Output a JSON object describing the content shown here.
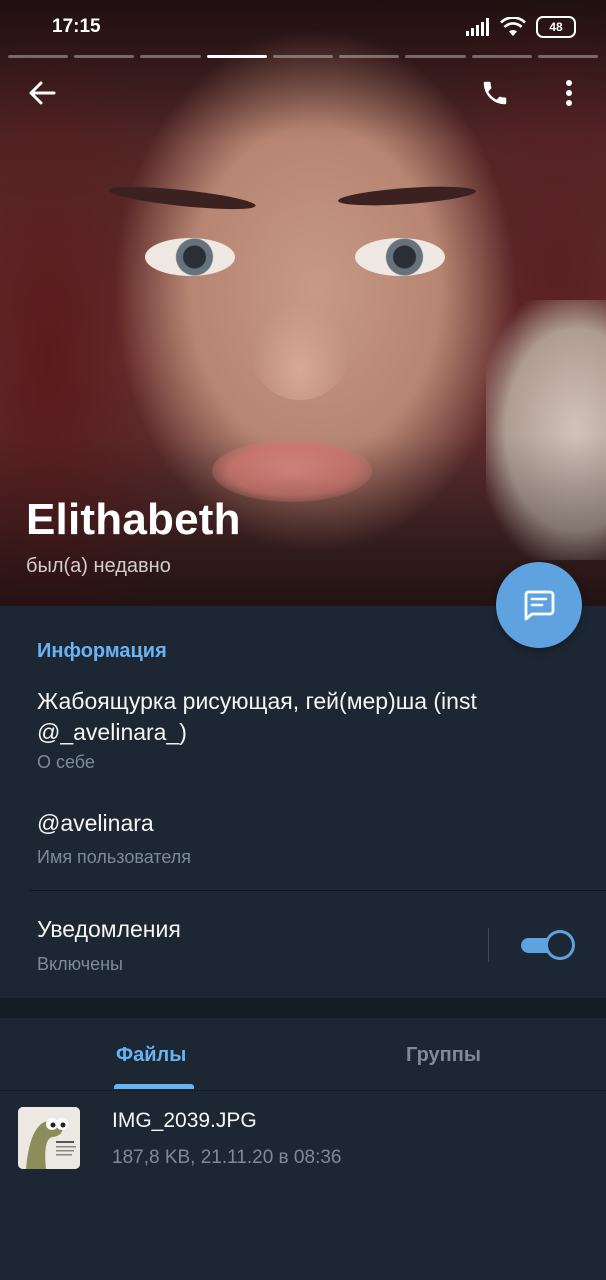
{
  "status_bar": {
    "time": "17:15",
    "battery": "48"
  },
  "profile": {
    "name": "Elithabeth",
    "last_seen": "был(а) недавно"
  },
  "info": {
    "section_title": "Информация",
    "bio": "Жабоящурка рисующая, гей(мер)ша (inst @_avelinara_)",
    "bio_label": "О себе",
    "username": "@avelinara",
    "username_label": "Имя пользователя",
    "notifications": "Уведомления",
    "notifications_state": "Включены",
    "notifications_enabled": true
  },
  "tabs": [
    {
      "label": "Файлы",
      "active": true
    },
    {
      "label": "Группы",
      "active": false
    }
  ],
  "files": [
    {
      "name": "IMG_2039.JPG",
      "meta": "187,8 KB, 21.11.20 в 08:36"
    }
  ],
  "icons": {
    "back": "arrow-left-icon",
    "call": "phone-icon",
    "more": "more-vertical-icon",
    "message": "message-icon"
  },
  "colors": {
    "accent": "#6ab3f3",
    "fab": "#5ea2e0",
    "background": "#1d2733",
    "secondary_text": "#7d8b99"
  }
}
